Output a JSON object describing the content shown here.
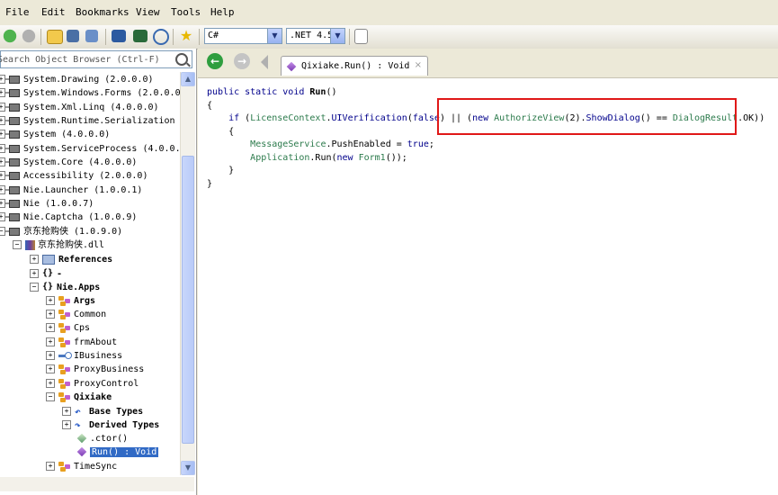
{
  "menu": [
    "File",
    "Edit",
    "Bookmarks",
    "View",
    "Tools",
    "Help"
  ],
  "toolbar": {
    "language": "C#",
    "framework": ".NET 4.5"
  },
  "search": {
    "placeholder": "Search Object Browser (Ctrl-F)"
  },
  "tree": [
    {
      "label": "System.Drawing (2.0.0.0)",
      "kind": "assembly"
    },
    {
      "label": "System.Windows.Forms (2.0.0.0)",
      "kind": "assembly"
    },
    {
      "label": "System.Xml.Linq (4.0.0.0)",
      "kind": "assembly"
    },
    {
      "label": "System.Runtime.Serialization",
      "kind": "assembly"
    },
    {
      "label": "System (4.0.0.0)",
      "kind": "assembly"
    },
    {
      "label": "System.ServiceProcess (4.0.0.0)",
      "kind": "assembly"
    },
    {
      "label": "System.Core (4.0.0.0)",
      "kind": "assembly"
    },
    {
      "label": "Accessibility (2.0.0.0)",
      "kind": "assembly"
    },
    {
      "label": "Nie.Launcher (1.0.0.1)",
      "kind": "assembly"
    },
    {
      "label": "Nie (1.0.0.7)",
      "kind": "assembly"
    },
    {
      "label": "Nie.Captcha (1.0.0.9)",
      "kind": "assembly"
    },
    {
      "label": "京东抢购侠 (1.0.9.0)",
      "kind": "assembly"
    },
    {
      "label": "京东抢购侠.dll",
      "kind": "dll"
    },
    {
      "label": "References",
      "kind": "references"
    },
    {
      "label": "-",
      "kind": "namespace"
    },
    {
      "label": "Nie.Apps",
      "kind": "namespace"
    },
    {
      "label": "Args",
      "kind": "class"
    },
    {
      "label": "Common",
      "kind": "class"
    },
    {
      "label": "Cps",
      "kind": "class"
    },
    {
      "label": "frmAbout",
      "kind": "class"
    },
    {
      "label": "IBusiness",
      "kind": "interface"
    },
    {
      "label": "ProxyBusiness",
      "kind": "class"
    },
    {
      "label": "ProxyControl",
      "kind": "class"
    },
    {
      "label": "Qixiake",
      "kind": "class"
    },
    {
      "label": "Base Types",
      "kind": "basetypes"
    },
    {
      "label": "Derived Types",
      "kind": "derivedtypes"
    },
    {
      "label": ".ctor()",
      "kind": "ctor"
    },
    {
      "label": "Run() : Void",
      "kind": "method"
    },
    {
      "label": "TimeSync",
      "kind": "class"
    }
  ],
  "tab": {
    "label": "Qixiake.Run() : Void",
    "close": "×"
  },
  "code": {
    "line1_a": "public static void ",
    "line1_b": "Run",
    "line1_c": "()",
    "line2": "{",
    "line3_if": "if",
    "line3_a": " (",
    "line3_lc": "LicenseContext",
    "line3_b": ".",
    "line3_uv": "UIVerification",
    "line3_c": "(",
    "line3_false": "false",
    "line3_d": ") || (",
    "line3_new": "new",
    "line3_av": " AuthorizeView",
    "line3_e": "(2).",
    "line3_sd": "ShowDialog",
    "line3_f": "() == ",
    "line3_dr": "DialogResult",
    "line3_g": ".OK))",
    "line4": "{",
    "line5_ms": "MessageService",
    "line5_a": ".PushEnabled = ",
    "line5_true": "true",
    "line5_b": ";",
    "line6_app": "Application",
    "line6_a": ".Run(",
    "line6_new": "new",
    "line6_f1": " Form1",
    "line6_b": "());",
    "line7": "}",
    "line8": "}"
  }
}
